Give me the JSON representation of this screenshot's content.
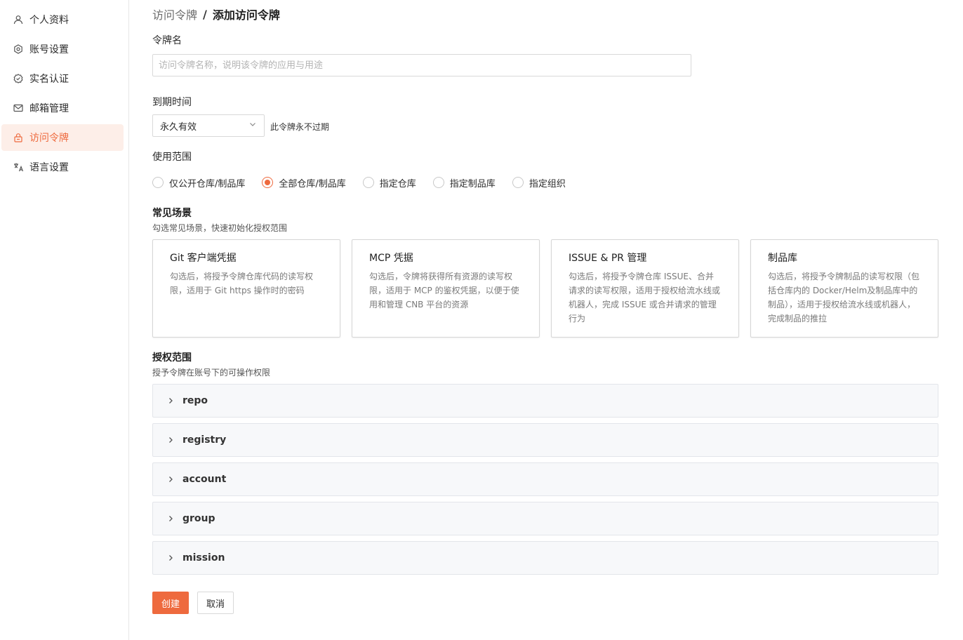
{
  "sidebar": {
    "items": [
      {
        "label": "个人资料",
        "icon": "user-icon"
      },
      {
        "label": "账号设置",
        "icon": "gear-icon"
      },
      {
        "label": "实名认证",
        "icon": "verified-badge-icon"
      },
      {
        "label": "邮箱管理",
        "icon": "mail-icon"
      },
      {
        "label": "访问令牌",
        "icon": "lock-icon",
        "active": true
      },
      {
        "label": "语言设置",
        "icon": "translate-icon"
      }
    ]
  },
  "breadcrumb": {
    "parent": "访问令牌",
    "separator": "/",
    "current": "添加访问令牌"
  },
  "form": {
    "name_label": "令牌名",
    "name_placeholder": "访问令牌名称，说明该令牌的应用与用途",
    "expiry_label": "到期时间",
    "expiry_value": "永久有效",
    "expiry_hint": "此令牌永不过期",
    "scope_label": "使用范围",
    "scope_options": [
      {
        "label": "仅公开仓库/制品库",
        "checked": false
      },
      {
        "label": "全部仓库/制品库",
        "checked": true
      },
      {
        "label": "指定仓库",
        "checked": false
      },
      {
        "label": "指定制品库",
        "checked": false
      },
      {
        "label": "指定组织",
        "checked": false
      }
    ]
  },
  "scenes": {
    "title": "常见场景",
    "desc": "勾选常见场景，快速初始化授权范围",
    "cards": [
      {
        "title": "Git 客户端凭据",
        "desc": "勾选后，将授予令牌仓库代码的读写权限，适用于 Git https 操作时的密码"
      },
      {
        "title": "MCP 凭据",
        "desc": "勾选后，令牌将获得所有资源的读写权限，适用于 MCP 的鉴权凭据，以便于使用和管理 CNB 平台的资源"
      },
      {
        "title": "ISSUE & PR 管理",
        "desc": "勾选后，将授予令牌仓库 ISSUE、合并请求的读写权限，适用于授权给流水线或机器人，完成 ISSUE 或合并请求的管理行为"
      },
      {
        "title": "制品库",
        "desc": "勾选后，将授予令牌制品的读写权限（包括仓库内的 Docker/Helm及制品库中的制品），适用于授权给流水线或机器人，完成制品的推拉"
      }
    ]
  },
  "permissions": {
    "title": "授权范围",
    "desc": "授予令牌在账号下的可操作权限",
    "groups": [
      "repo",
      "registry",
      "account",
      "group",
      "mission"
    ]
  },
  "actions": {
    "create_label": "创建",
    "cancel_label": "取消"
  },
  "colors": {
    "accent": "#ee6a3e",
    "active_bg": "#fdeee8"
  }
}
